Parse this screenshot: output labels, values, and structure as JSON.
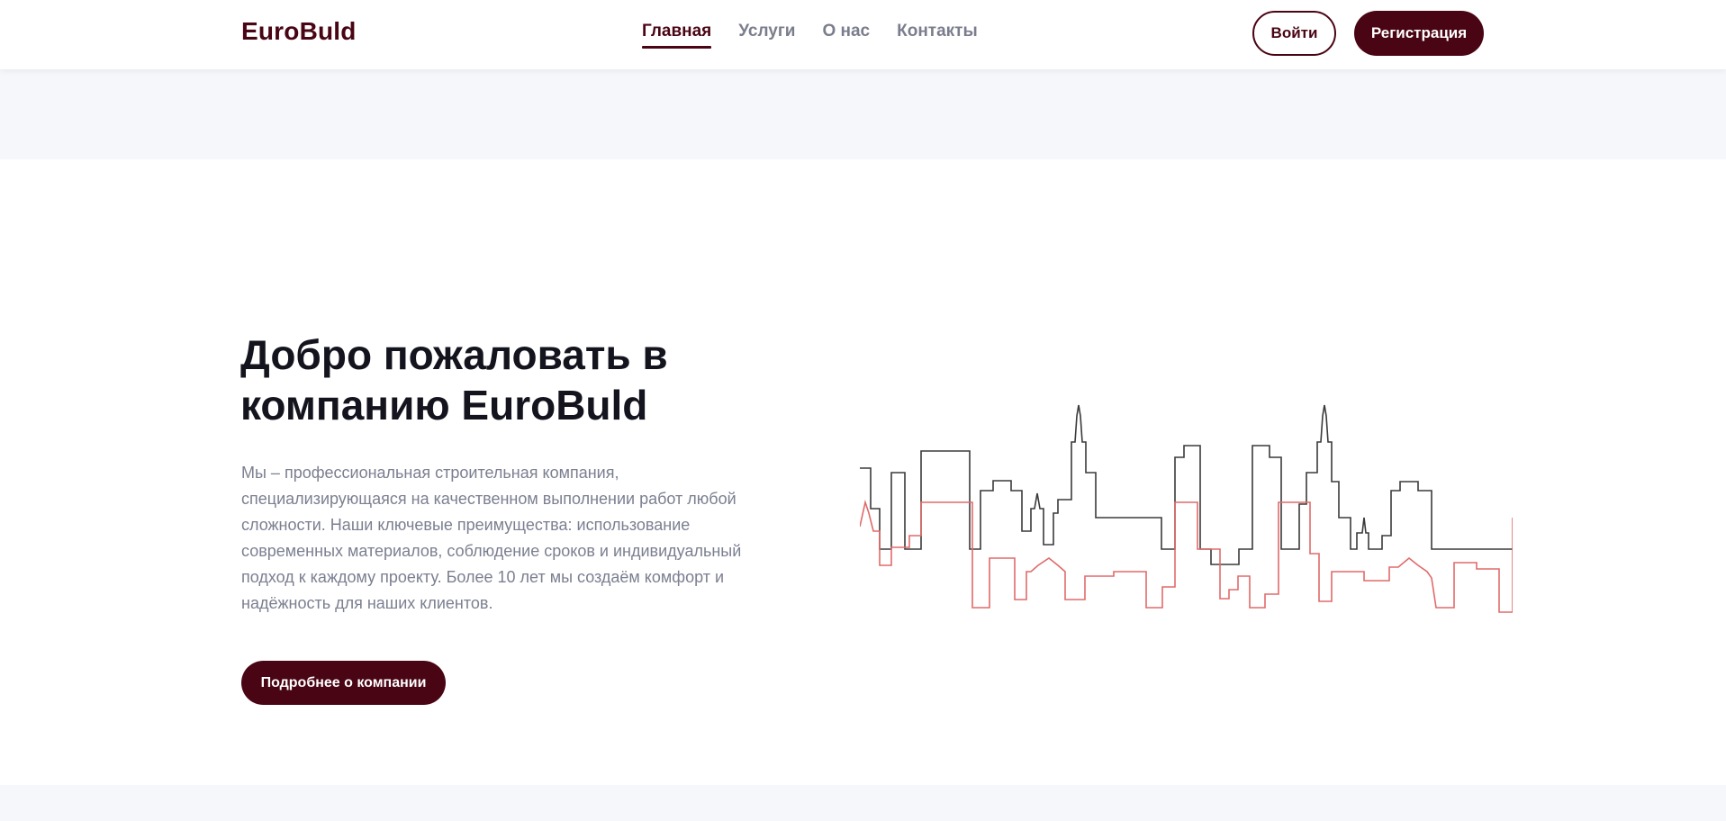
{
  "header": {
    "logo": "EuroBuld",
    "nav": [
      {
        "label": "Главная",
        "active": true
      },
      {
        "label": "Услуги",
        "active": false
      },
      {
        "label": "О нас",
        "active": false
      },
      {
        "label": "Контакты",
        "active": false
      }
    ],
    "login_label": "Войти",
    "register_label": "Регистрация"
  },
  "hero": {
    "title": "Добро пожаловать в компанию EuroBuld",
    "text": "Мы – профессиональная строительная компания, специализирующаяся на качественном выполнении работ любой сложности. Наши ключевые преимущества: использование современных материалов, соблюдение сроков и индивидуальный подход к каждому проекту. Более 10 лет мы создаём комфорт и надёжность для наших клиентов.",
    "button_label": "Подробнее о компании",
    "illustration": "city-skyline-icon"
  },
  "colors": {
    "brand": "#4a0514",
    "nav_inactive": "#7a7d8c",
    "band": "#f5f7fb",
    "skyline_dark": "#3a3a3a",
    "skyline_red": "#e06a6a"
  }
}
